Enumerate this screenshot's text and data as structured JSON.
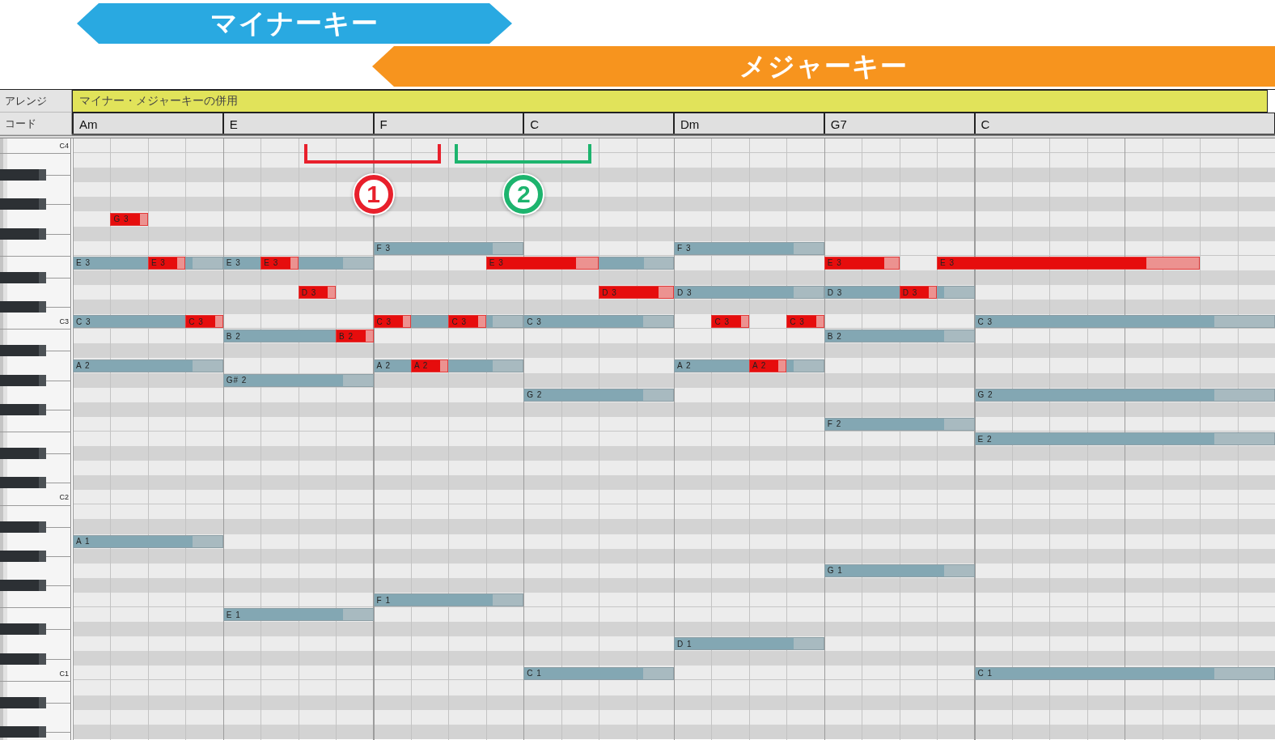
{
  "banners": [
    {
      "label": "マイナーキー",
      "kind": "minor"
    },
    {
      "label": "メジャーキー",
      "kind": "major"
    }
  ],
  "arrange_row": {
    "label": "アレンジ",
    "value": "マイナー・メジャーキーの併用"
  },
  "chord_row": {
    "label": "コード",
    "chords": [
      "Am",
      "E",
      "F",
      "C",
      "Dm",
      "G7",
      "C"
    ]
  },
  "keyboard": {
    "octave_labels": [
      "C4",
      "C3",
      "C2",
      "C1"
    ]
  },
  "annotations": [
    {
      "label": "1",
      "color": "#e8202c"
    },
    {
      "label": "2",
      "color": "#1db46e"
    }
  ],
  "notes": [
    {
      "label": "E 3",
      "highlighted": false
    },
    {
      "label": "C 3",
      "highlighted": false
    },
    {
      "label": "A 2",
      "highlighted": false
    },
    {
      "label": "A 1",
      "highlighted": false
    },
    {
      "label": "G 3",
      "highlighted": true
    },
    {
      "label": "E 3",
      "highlighted": true
    },
    {
      "label": "C 3",
      "highlighted": true
    },
    {
      "label": "E 3",
      "highlighted": false
    },
    {
      "label": "B 2",
      "highlighted": false
    },
    {
      "label": "G# 2",
      "highlighted": false
    },
    {
      "label": "E 1",
      "highlighted": false
    },
    {
      "label": "E 3",
      "highlighted": true
    },
    {
      "label": "D 3",
      "highlighted": true
    },
    {
      "label": "B 2",
      "highlighted": true
    },
    {
      "label": "F 3",
      "highlighted": false
    },
    {
      "label": "C 3",
      "highlighted": true
    },
    {
      "label": "A 2",
      "highlighted": false
    },
    {
      "label": "F 1",
      "highlighted": false
    },
    {
      "highlighted": false
    },
    {
      "label": "A 2",
      "highlighted": true
    },
    {
      "label": "C 3",
      "highlighted": true
    },
    {
      "label": "E 3",
      "highlighted": true
    },
    {
      "label": "C 3",
      "highlighted": false
    },
    {
      "label": "G 2",
      "highlighted": false
    },
    {
      "label": "C 1",
      "highlighted": false
    },
    {
      "highlighted": false
    },
    {
      "label": "D 3",
      "highlighted": true
    },
    {
      "label": "F 3",
      "highlighted": false
    },
    {
      "label": "D 3",
      "highlighted": false
    },
    {
      "label": "A 2",
      "highlighted": false
    },
    {
      "label": "D 1",
      "highlighted": false
    },
    {
      "label": "C 3",
      "highlighted": true
    },
    {
      "label": "A 2",
      "highlighted": true
    },
    {
      "label": "C 3",
      "highlighted": true
    },
    {
      "label": "E 3",
      "highlighted": true
    },
    {
      "label": "D 3",
      "highlighted": false
    },
    {
      "label": "B 2",
      "highlighted": false
    },
    {
      "label": "F 2",
      "highlighted": false
    },
    {
      "label": "G 1",
      "highlighted": false
    },
    {
      "label": "D 3",
      "highlighted": true
    },
    {
      "label": "E 3",
      "highlighted": true
    },
    {
      "label": "C 3",
      "highlighted": false
    },
    {
      "label": "G 2",
      "highlighted": false
    },
    {
      "label": "E 2",
      "highlighted": false
    },
    {
      "label": "C 1",
      "highlighted": false
    }
  ]
}
